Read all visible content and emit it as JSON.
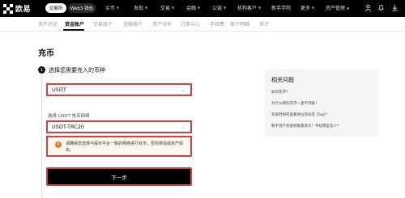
{
  "topnav": {
    "logo_text": "欧易",
    "tab_exchange": "交易所",
    "tab_web3": "Web3 钱包",
    "items": [
      {
        "label": "买币"
      },
      {
        "label": "发现"
      },
      {
        "label": "交易"
      },
      {
        "label": "金融"
      },
      {
        "label": "公链"
      },
      {
        "label": "机构客户"
      },
      {
        "label": "新手学院"
      },
      {
        "label": "更多"
      }
    ],
    "asset_mgmt": "资产管理"
  },
  "subnav": {
    "tabs": [
      {
        "label": "资产总览",
        "active": false
      },
      {
        "label": "资金账户",
        "active": true
      },
      {
        "label": "交易账户",
        "active": false
      },
      {
        "label": "金融账户",
        "active": false
      },
      {
        "label": "资产分析",
        "active": false
      },
      {
        "label": "订单中心",
        "active": false
      },
      {
        "label": "手续费",
        "active": false
      },
      {
        "label": "账户明细",
        "active": false
      },
      {
        "label": "审计",
        "active": false
      }
    ]
  },
  "page": {
    "title": "充币",
    "step_number": "1",
    "step_title": "选择您需要充入的币种",
    "coin_value": "USDT",
    "network_label": "选择 USDT 充币网络",
    "network_value": "USDT-TRC20",
    "warning_text": "请确保您选择与提币平台一致的网络进行充币，否则将造成资产损失。",
    "next_button": "下一步"
  },
  "faq": {
    "title": "相关问题",
    "items": [
      {
        "label": "如何充币？"
      },
      {
        "label": "为什么我的充币一直不到账？"
      },
      {
        "label": "充值时如何查看地址及标签 (Tag)？"
      },
      {
        "label": "数字资产充值到账需多久？手续费是多少？"
      }
    ]
  },
  "colors": {
    "highlight_red": "#d64040",
    "warning_orange": "#e07a2a",
    "primary_black": "#000000"
  }
}
